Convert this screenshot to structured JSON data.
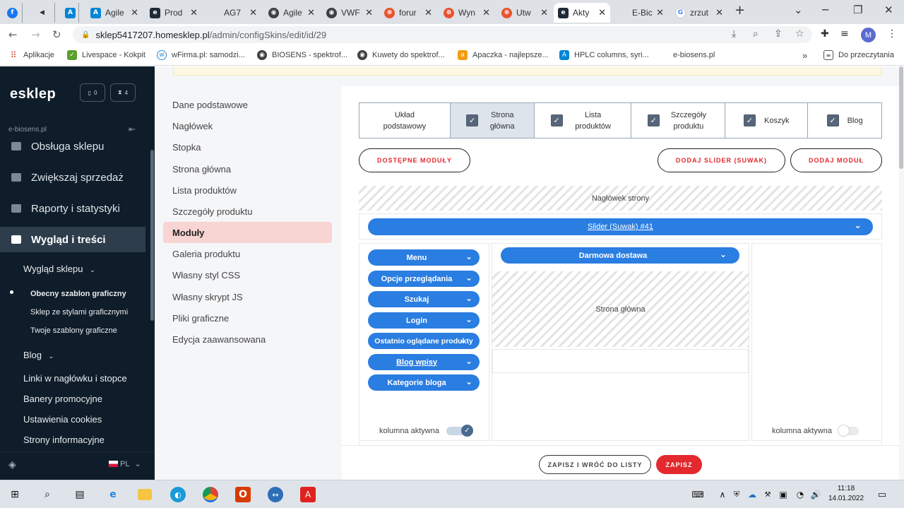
{
  "browser": {
    "tabs": [
      {
        "label": "",
        "icon": "facebook-icon",
        "color": "#1877f2"
      },
      {
        "label": "",
        "icon": "speaker-icon",
        "color": "#555555"
      },
      {
        "label": "",
        "icon": "agilent-icon",
        "color": "#0085d5"
      },
      {
        "label": "Agile",
        "icon": "agilent-icon",
        "color": "#0085d5"
      },
      {
        "label": "Prod",
        "icon": "esklep-icon",
        "color": "#1f2a36"
      },
      {
        "label": "AG7",
        "icon": "blank-icon",
        "color": "#dee1e6"
      },
      {
        "label": "Agile",
        "icon": "globe-icon",
        "color": "#3c4043"
      },
      {
        "label": "VWF",
        "icon": "globe-icon",
        "color": "#3c4043"
      },
      {
        "label": "forur",
        "icon": "lifebuoy-icon",
        "color": "#e8542f"
      },
      {
        "label": "Wyn",
        "icon": "lifebuoy-icon",
        "color": "#e8542f"
      },
      {
        "label": "Utw",
        "icon": "lifebuoy-icon",
        "color": "#e8542f"
      },
      {
        "label": "Akty",
        "icon": "esklep-icon",
        "color": "#1f2a36"
      },
      {
        "label": "E-Bic",
        "icon": "blank-icon",
        "color": "#dee1e6"
      },
      {
        "label": "zrzut",
        "icon": "google-icon",
        "color": "#4285f4"
      }
    ],
    "new_tab": "+",
    "url_host": "sklep5417207.homesklep.pl",
    "url_path": "/admin/configSkins/edit/id/29",
    "avatar": "M",
    "bookmarks": [
      {
        "label": "Aplikacje",
        "icon": "apps-grid-icon",
        "color": "#d23f31"
      },
      {
        "label": "Livespace - Kokpit",
        "icon": "livespace-icon",
        "color": "#5aa02c"
      },
      {
        "label": "wFirma.pl: samodzi...",
        "icon": "wfirma-icon",
        "color": "#2a8fd6"
      },
      {
        "label": "BIOSENS - spektrof...",
        "icon": "globe-icon",
        "color": "#3c4043"
      },
      {
        "label": "Kuwety do spektrof...",
        "icon": "globe-icon",
        "color": "#3c4043"
      },
      {
        "label": "Apaczka - najlepsze...",
        "icon": "apaczka-icon",
        "color": "#f39c12"
      },
      {
        "label": "HPLC columns, syri...",
        "icon": "agilent-icon",
        "color": "#0085d5"
      },
      {
        "label": "e-biosens.pl",
        "icon": "blank-icon",
        "color": "#ffffff"
      }
    ],
    "bookmarks_more": "»",
    "reading_list": "Do przeczytania"
  },
  "sidebar": {
    "logo": "esklep",
    "badge_orders": "0",
    "badge_timer": "4",
    "store_name": "e-biosens.pl",
    "nav": [
      {
        "label": "Obsługa sklepu",
        "active": false
      },
      {
        "label": "Zwiększaj sprzedaż",
        "active": false
      },
      {
        "label": "Raporty i statystyki",
        "active": false
      },
      {
        "label": "Wygląd i treści",
        "active": true
      }
    ],
    "sub": {
      "wyglad_sklepu": "Wygląd sklepu",
      "items": [
        "Obecny szablon graficzny",
        "Sklep ze stylami graficznymi",
        "Twoje szablony graficzne"
      ],
      "blog": "Blog",
      "links": [
        "Linki w nagłówku i stopce",
        "Banery promocyjne",
        "Ustawienia cookies",
        "Strony informacyjne"
      ]
    },
    "language": "PL"
  },
  "config_menu": {
    "items": [
      "Dane podstawowe",
      "Nagłówek",
      "Stopka",
      "Strona główna",
      "Lista produktów",
      "Szczegóły produktu",
      "Moduły",
      "Galeria produktu",
      "Własny styl CSS",
      "Własny skrypt JS",
      "Pliki graficzne",
      "Edycja zaawansowana"
    ],
    "active": "Moduły"
  },
  "layout_tabs": [
    {
      "label": "Układ podstawowy",
      "checkbox": false,
      "selected": false
    },
    {
      "label": "Strona główna",
      "checkbox": true,
      "selected": true
    },
    {
      "label": "Lista produktów",
      "checkbox": true,
      "selected": false
    },
    {
      "label": "Szczegóły produktu",
      "checkbox": true,
      "selected": false
    },
    {
      "label": "Koszyk",
      "checkbox": true,
      "selected": false
    },
    {
      "label": "Blog",
      "checkbox": true,
      "selected": false
    }
  ],
  "actions": {
    "available_modules": "DOSTĘPNE MODUŁY",
    "add_slider": "DODAJ SLIDER (SUWAK)",
    "add_module": "DODAJ MODUŁ"
  },
  "canvas": {
    "header_zone": "Nagłówek strony",
    "slider": "Slider (Suwak) #41",
    "left_modules": [
      "Menu",
      "Opcje przeglądania",
      "Szukaj",
      "Login",
      "Ostatnio oglądane produkty",
      "Blog wpisy",
      "Kategorie bloga"
    ],
    "center_module": "Darmowa dostawa",
    "center_zone": "Strona główna",
    "left_column_toggle": "kolumna aktywna",
    "left_column_active": true,
    "right_column_toggle": "kolumna aktywna",
    "right_column_active": false
  },
  "footer": {
    "save_back": "ZAPISZ I WRÓĆ DO LISTY",
    "save": "ZAPISZ"
  },
  "taskbar": {
    "time": "11:18",
    "date": "14.01.2022"
  },
  "colors": {
    "accent_blue": "#2a7de1",
    "accent_red": "#e3292e",
    "sidebar_bg": "#0f1d2a",
    "active_menu_bg": "#f8d4d2"
  }
}
